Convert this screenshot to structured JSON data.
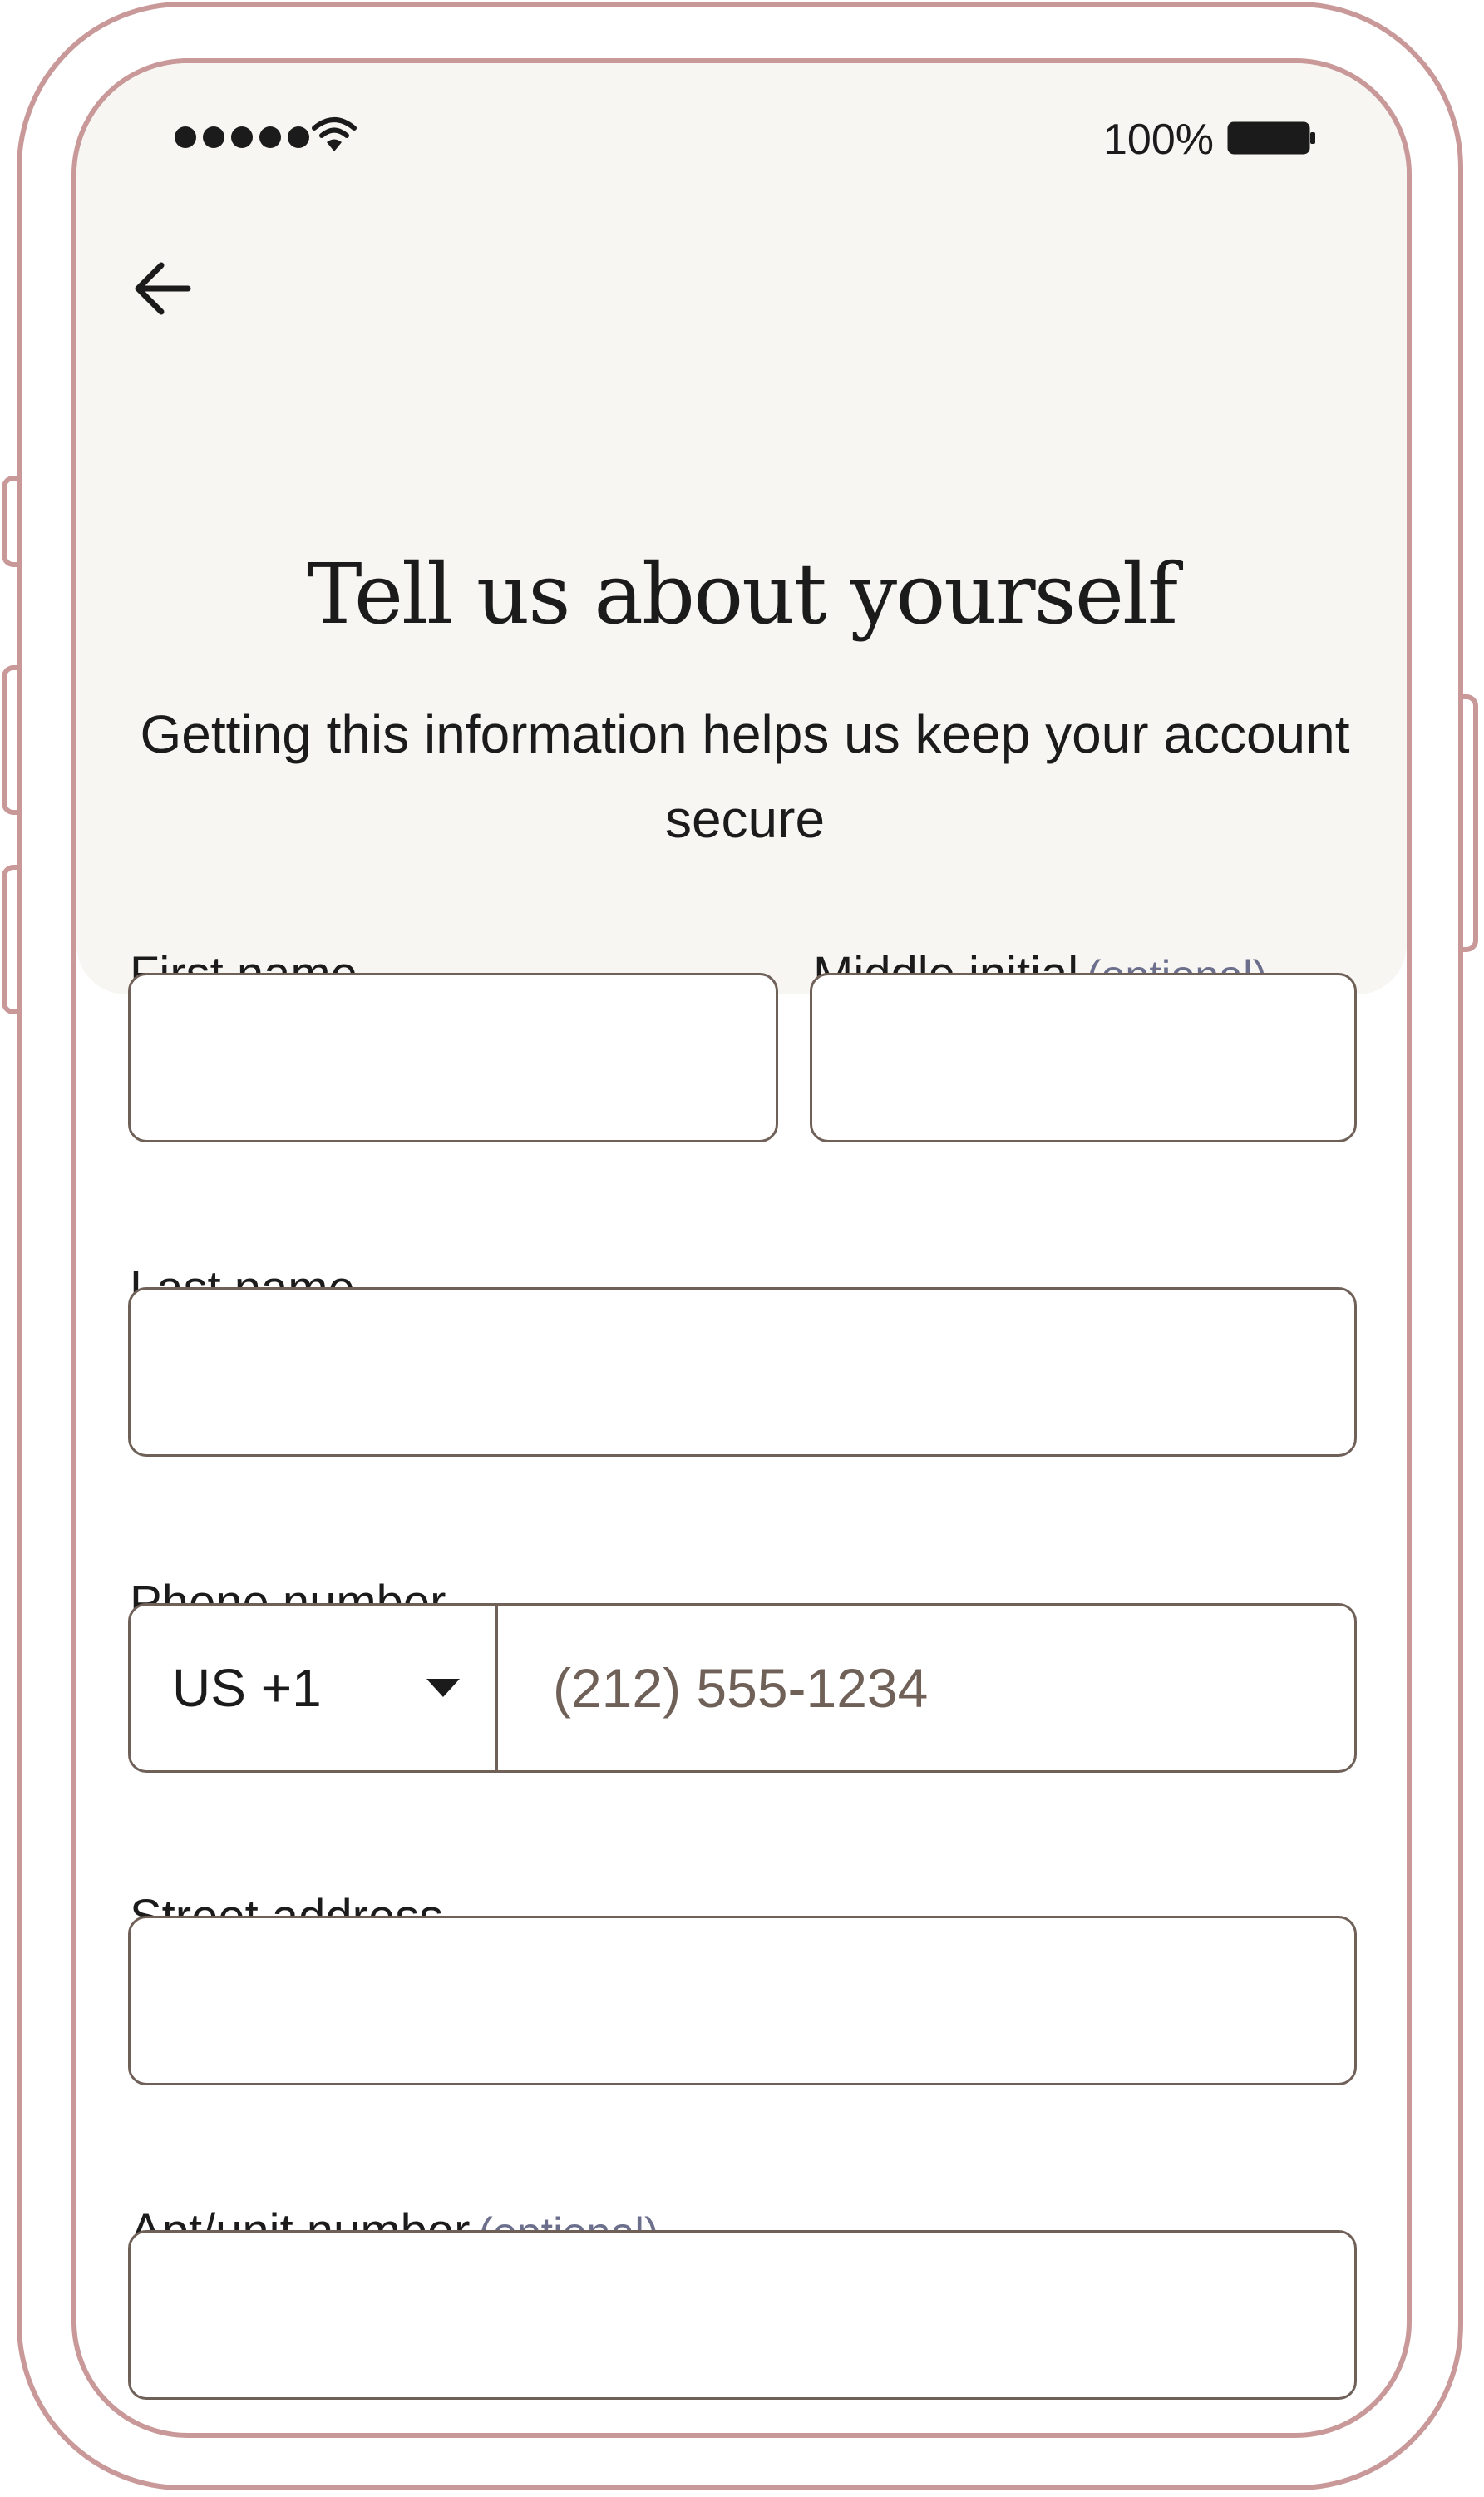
{
  "status_bar": {
    "signal_icon": "signal-dots-icon",
    "wifi_icon": "wifi-icon",
    "battery_percent": "100%",
    "battery_icon": "battery-full-icon"
  },
  "nav": {
    "back_icon": "arrow-left-icon"
  },
  "header": {
    "title": "Tell us about yourself",
    "subtitle": "Getting this information helps us keep your account secure"
  },
  "form": {
    "first_name": {
      "label": "First name",
      "value": ""
    },
    "middle_initial": {
      "label": "Middle initial",
      "optional": "(optional)",
      "value": ""
    },
    "last_name": {
      "label": "Last name",
      "value": ""
    },
    "phone": {
      "label": "Phone number",
      "country_code": "US +1",
      "placeholder": "(212) 555-1234",
      "value": ""
    },
    "street_address": {
      "label": "Street address",
      "value": ""
    },
    "apt_unit": {
      "label": "Apt/unit number",
      "optional": "(optional)",
      "value": ""
    }
  },
  "colors": {
    "frame": "#c99899",
    "screen_top": "#f7f6f3",
    "field_border": "#6f6058",
    "optional_text": "#6c6f8c",
    "text": "#1b1b1b"
  }
}
